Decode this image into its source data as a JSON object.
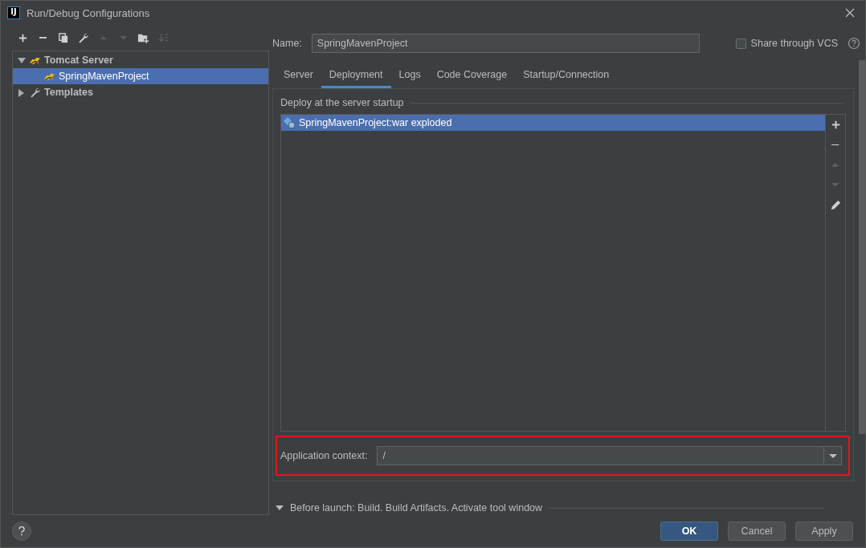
{
  "window": {
    "title": "Run/Debug Configurations",
    "logo": "IJ"
  },
  "toolbar": [
    {
      "kind": "add",
      "disabled": false
    },
    {
      "kind": "remove",
      "disabled": false
    },
    {
      "kind": "copy",
      "disabled": false
    },
    {
      "kind": "wrench",
      "disabled": false
    },
    {
      "kind": "up",
      "disabled": true
    },
    {
      "kind": "down",
      "disabled": true
    },
    {
      "kind": "folder",
      "disabled": false
    },
    {
      "kind": "sort",
      "disabled": true
    }
  ],
  "tree": [
    {
      "label": "Tomcat Server",
      "kind": "tomcat",
      "expanded": true,
      "selected": false,
      "children": [
        {
          "label": "SpringMavenProject",
          "kind": "tomcat",
          "selected": true
        }
      ]
    },
    {
      "label": "Templates",
      "kind": "wrench",
      "expanded": false,
      "selected": false
    }
  ],
  "name": {
    "label": "Name:",
    "value": "SpringMavenProject"
  },
  "share": {
    "label": "Share through VCS",
    "checked": false
  },
  "tabs": [
    {
      "label": "Server",
      "selected": false
    },
    {
      "label": "Deployment",
      "selected": true
    },
    {
      "label": "Logs",
      "selected": false
    },
    {
      "label": "Code Coverage",
      "selected": false
    },
    {
      "label": "Startup/Connection",
      "selected": false
    }
  ],
  "deploy": {
    "title": "Deploy at the server startup",
    "items": [
      {
        "label": "SpringMavenProject:war exploded",
        "selected": true
      }
    ],
    "side_buttons": [
      {
        "kind": "add",
        "disabled": false
      },
      {
        "kind": "remove",
        "disabled": false
      },
      {
        "kind": "up",
        "disabled": true
      },
      {
        "kind": "down",
        "disabled": true
      },
      {
        "kind": "edit",
        "disabled": false
      }
    ]
  },
  "application_context": {
    "label": "Application context:",
    "value": "/",
    "highlighted": true
  },
  "before_launch": {
    "label": "Before launch: Build. Build Artifacts. Activate tool window",
    "expanded": true
  },
  "buttons": [
    {
      "label": "OK",
      "kind": "default"
    },
    {
      "label": "Cancel",
      "kind": "normal"
    },
    {
      "label": "Apply",
      "kind": "normal"
    }
  ]
}
